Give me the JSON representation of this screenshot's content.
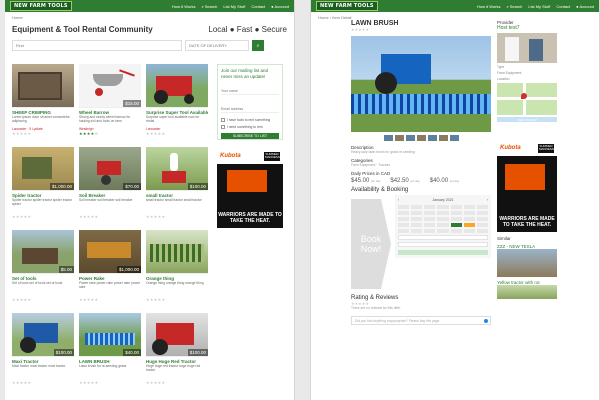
{
  "site": {
    "logo": "NEW FARM TOOLS",
    "nav": [
      "How it Works",
      "Search",
      "List My Stuff",
      "Contact",
      "Account"
    ]
  },
  "left": {
    "breadcrumb": "Home",
    "title": "Equipment & Tool Rental Community",
    "tagline": "Local ● Fast ● Secure",
    "search": {
      "what_placeholder": "Find",
      "date_placeholder": "DATE OF DELIVERY"
    },
    "listings": [
      {
        "title": "SHEEP CRIMPING",
        "price": "",
        "desc": "Lorem ipsum dolor sit amet consectetur adipiscing",
        "meta": "Lancaster · 5 Lydiate",
        "stars": 0
      },
      {
        "title": "Wheel Barrow",
        "price": "$15.00",
        "desc": "Strong and sturdy wheel barrow for hauling soil and tools on farm",
        "meta": "Westleigh",
        "stars": 4
      },
      {
        "title": "Surprise Super Tool Available",
        "price": "",
        "desc": "Surprise super tool available now for rental",
        "meta": "Lancaster",
        "stars": 0
      },
      {
        "title": "Spider tractor",
        "price": "$1,000.00",
        "desc": "Spider tractor spider tractor spider tractor spider",
        "meta": "",
        "stars": 0
      },
      {
        "title": "Soil Breaker",
        "price": "$70.00",
        "desc": "Soil breaker soil breaker soil breaker",
        "meta": "",
        "stars": 0
      },
      {
        "title": "small tractor",
        "price": "$100.00",
        "desc": "small tractor small tractor small tractor",
        "meta": "",
        "stars": 0
      },
      {
        "title": "Set of tools",
        "price": "$5.00",
        "desc": "Set of tools set of tools set of tools",
        "meta": "",
        "stars": 0
      },
      {
        "title": "Power Rake",
        "price": "$1,000.00",
        "desc": "Power rake power rake power rake power rake",
        "meta": "",
        "stars": 0
      },
      {
        "title": "Orange thing",
        "price": "",
        "desc": "Orange thing orange thing orange thing",
        "meta": "",
        "stars": 0
      },
      {
        "title": "Maxi Tractor",
        "price": "$100.00",
        "desc": "Maxi tractor maxi tractor maxi tractor",
        "meta": "",
        "stars": 0
      },
      {
        "title": "LAWN BRUSH",
        "price": "$40.00",
        "desc": "Lawn brush for re-seeding grass",
        "meta": "",
        "stars": 0
      },
      {
        "title": "Huge Huge Red Tractor",
        "price": "$100.00",
        "desc": "Huge huge red tractor huge huge red tractor",
        "meta": "",
        "stars": 0
      }
    ],
    "mailing": {
      "title": "Join our mailing list and never miss an update!",
      "name_placeholder": "Your name",
      "email_placeholder": "Email address",
      "check1": "I have tools to rent something",
      "check2": "I need something to rent",
      "button": "SUBSCRIBE TO LIST"
    },
    "ad": {
      "brand": "Kubota",
      "badge": "SUMMER MADNESS",
      "headline": "WARRIORS ARE MADE TO TAKE THE HEAT."
    }
  },
  "right": {
    "breadcrumb": "Home › Item Detail",
    "title": "LAWN BRUSH",
    "description_label": "Description",
    "description": "Heavy-duty lawn brush for grass re-seeding",
    "categories_label": "Categories",
    "categories": "Farm Equipment · Tractors",
    "prices_label": "Daily Prices in CAD",
    "prices": [
      {
        "amount": "$45.00",
        "unit": "per day"
      },
      {
        "amount": "$42.50",
        "unit": "per day"
      },
      {
        "amount": "$40.00",
        "unit": "per day"
      }
    ],
    "booking_label": "Availability & Booking",
    "book_now": "Book Now!",
    "calendar_month": "January 2021",
    "rating_label": "Rating & Reviews",
    "no_reviews": "There are no reviews for this offer.",
    "question_placeholder": "Did you find anything inappropriate? Please flag this page",
    "provider_label": "Provider",
    "provider_name": "Host test7",
    "type_label": "Type",
    "type_value": "Farm Equipment",
    "location_label": "Location",
    "map_button": "VIEW ON MAP",
    "similar_label": "Similar",
    "similar": [
      {
        "title": "ZZZ - NEW TESLA"
      },
      {
        "title": "Yellow tractor with rot"
      }
    ]
  },
  "colors": {
    "brand_green": "#2e7d32",
    "ad_orange": "#e65100"
  }
}
